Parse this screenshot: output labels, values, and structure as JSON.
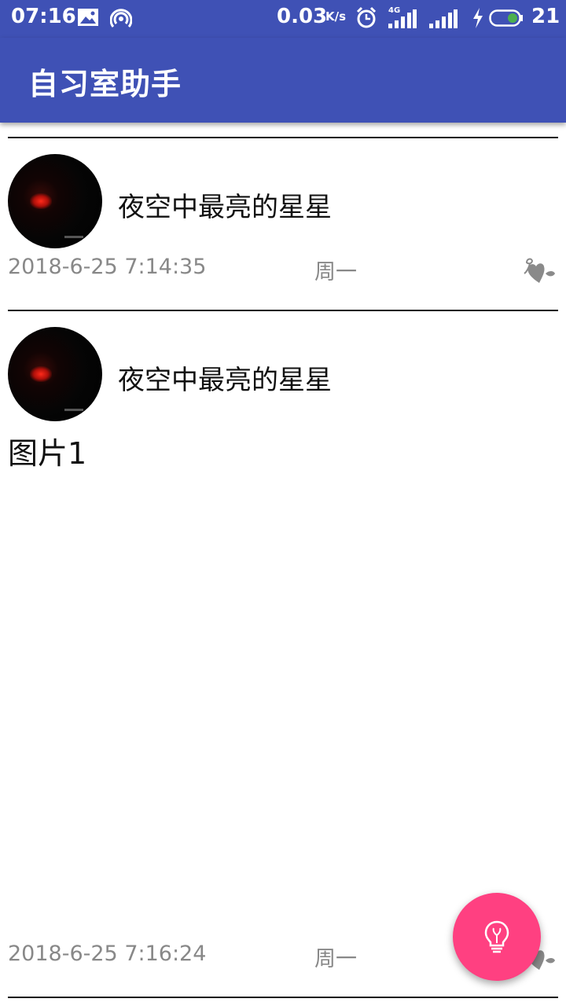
{
  "status_bar": {
    "time": "07:16",
    "net_speed": "0.03",
    "net_unit": "K/s",
    "network_badge": "4G",
    "battery": "21",
    "icons": [
      "image-icon",
      "hotspot-icon",
      "alarm-icon",
      "signal-4g-icon",
      "signal-icon",
      "charging-icon",
      "battery-icon"
    ]
  },
  "app_bar": {
    "title": "自习室助手"
  },
  "posts": [
    {
      "author": "夜空中最亮的星星",
      "body": "",
      "datetime": "2018-6-25 7:14:35",
      "weekday": "周一",
      "like_icon": "heart-flower-icon"
    },
    {
      "author": "夜空中最亮的星星",
      "body": "图片1",
      "datetime": "2018-6-25 7:16:24",
      "weekday": "周一",
      "like_icon": "heart-flower-icon"
    }
  ],
  "fab": {
    "icon": "lightbulb-icon"
  },
  "colors": {
    "primary": "#3f51b5",
    "accent": "#ff4081",
    "meta_text": "#888888"
  }
}
